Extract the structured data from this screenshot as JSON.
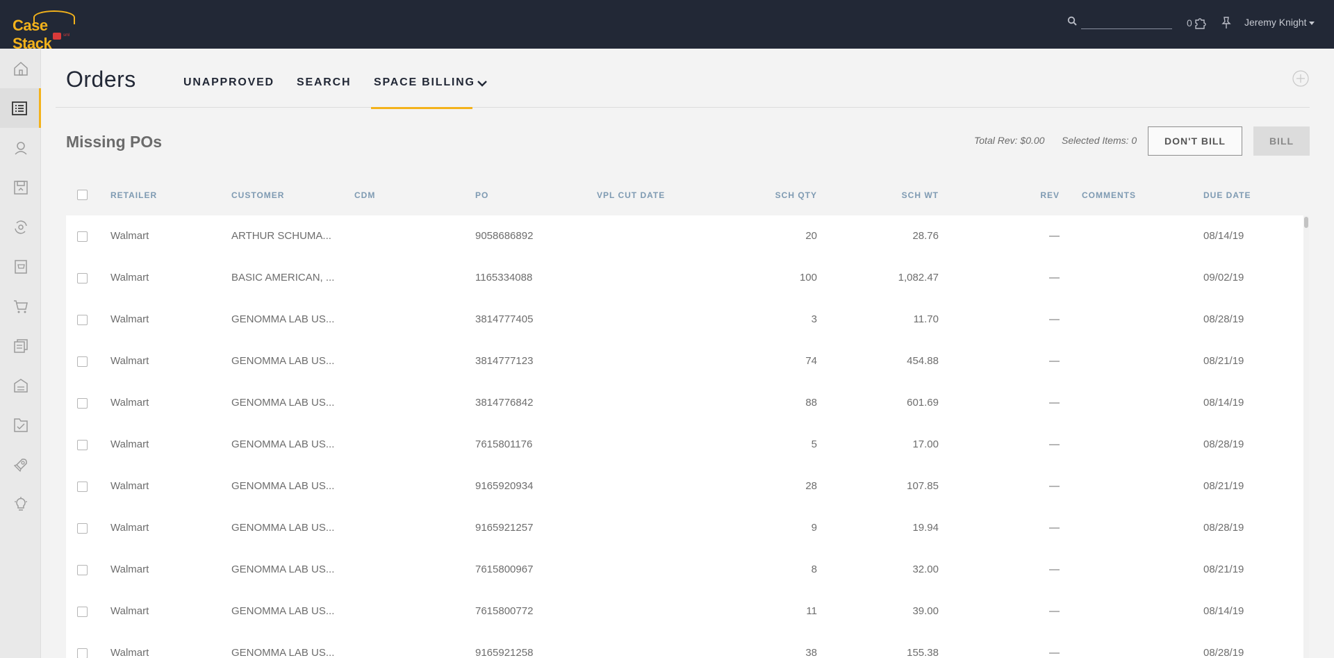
{
  "app": {
    "logo_text": "Case Stack",
    "logo_badge_text": "sml",
    "user_name": "Jeremy Knight",
    "notification_count": "0",
    "search": {
      "placeholder": "",
      "value": ""
    }
  },
  "sidebar": {
    "items": [
      {
        "icon": "home-icon"
      },
      {
        "icon": "orders-list-icon",
        "active": true
      },
      {
        "icon": "contacts-icon"
      },
      {
        "icon": "save-upload-icon"
      },
      {
        "icon": "integrations-icon"
      },
      {
        "icon": "cart-box-icon"
      },
      {
        "icon": "shopping-cart-icon"
      },
      {
        "icon": "documents-icon"
      },
      {
        "icon": "warehouse-icon"
      },
      {
        "icon": "checklist-icon"
      },
      {
        "icon": "rocket-icon"
      },
      {
        "icon": "lightbulb-icon"
      }
    ]
  },
  "header": {
    "title": "Orders",
    "tabs": [
      {
        "label": "UNAPPROVED"
      },
      {
        "label": "SEARCH"
      },
      {
        "label": "SPACE BILLING",
        "active": true
      }
    ]
  },
  "section": {
    "title": "Missing POs",
    "total_rev": "Total Rev: $0.00",
    "selected_items": "Selected Items: 0",
    "dont_bill_label": "DON'T BILL",
    "bill_label": "BILL"
  },
  "table": {
    "columns": [
      "RETAILER",
      "CUSTOMER",
      "CDM",
      "PO",
      "VPL CUT DATE",
      "SCH QTY",
      "SCH WT",
      "REV",
      "COMMENTS",
      "DUE DATE"
    ],
    "rows": [
      {
        "retailer": "Walmart",
        "customer": "ARTHUR SCHUMA...",
        "cdm": "",
        "po": "9058686892",
        "vpl_cut_date": "",
        "sch_qty": "20",
        "sch_wt": "28.76",
        "rev": "—",
        "comments": "",
        "due_date": "08/14/19"
      },
      {
        "retailer": "Walmart",
        "customer": "BASIC AMERICAN, ...",
        "cdm": "",
        "po": "1165334088",
        "vpl_cut_date": "",
        "sch_qty": "100",
        "sch_wt": "1,082.47",
        "rev": "—",
        "comments": "",
        "due_date": "09/02/19"
      },
      {
        "retailer": "Walmart",
        "customer": "GENOMMA LAB US...",
        "cdm": "",
        "po": "3814777405",
        "vpl_cut_date": "",
        "sch_qty": "3",
        "sch_wt": "11.70",
        "rev": "—",
        "comments": "",
        "due_date": "08/28/19"
      },
      {
        "retailer": "Walmart",
        "customer": "GENOMMA LAB US...",
        "cdm": "",
        "po": "3814777123",
        "vpl_cut_date": "",
        "sch_qty": "74",
        "sch_wt": "454.88",
        "rev": "—",
        "comments": "",
        "due_date": "08/21/19"
      },
      {
        "retailer": "Walmart",
        "customer": "GENOMMA LAB US...",
        "cdm": "",
        "po": "3814776842",
        "vpl_cut_date": "",
        "sch_qty": "88",
        "sch_wt": "601.69",
        "rev": "—",
        "comments": "",
        "due_date": "08/14/19"
      },
      {
        "retailer": "Walmart",
        "customer": "GENOMMA LAB US...",
        "cdm": "",
        "po": "7615801176",
        "vpl_cut_date": "",
        "sch_qty": "5",
        "sch_wt": "17.00",
        "rev": "—",
        "comments": "",
        "due_date": "08/28/19"
      },
      {
        "retailer": "Walmart",
        "customer": "GENOMMA LAB US...",
        "cdm": "",
        "po": "9165920934",
        "vpl_cut_date": "",
        "sch_qty": "28",
        "sch_wt": "107.85",
        "rev": "—",
        "comments": "",
        "due_date": "08/21/19"
      },
      {
        "retailer": "Walmart",
        "customer": "GENOMMA LAB US...",
        "cdm": "",
        "po": "9165921257",
        "vpl_cut_date": "",
        "sch_qty": "9",
        "sch_wt": "19.94",
        "rev": "—",
        "comments": "",
        "due_date": "08/28/19"
      },
      {
        "retailer": "Walmart",
        "customer": "GENOMMA LAB US...",
        "cdm": "",
        "po": "7615800967",
        "vpl_cut_date": "",
        "sch_qty": "8",
        "sch_wt": "32.00",
        "rev": "—",
        "comments": "",
        "due_date": "08/21/19"
      },
      {
        "retailer": "Walmart",
        "customer": "GENOMMA LAB US...",
        "cdm": "",
        "po": "7615800772",
        "vpl_cut_date": "",
        "sch_qty": "11",
        "sch_wt": "39.00",
        "rev": "—",
        "comments": "",
        "due_date": "08/14/19"
      },
      {
        "retailer": "Walmart",
        "customer": "GENOMMA LAB US...",
        "cdm": "",
        "po": "9165921258",
        "vpl_cut_date": "",
        "sch_qty": "38",
        "sch_wt": "155.38",
        "rev": "—",
        "comments": "",
        "due_date": "08/28/19"
      }
    ]
  },
  "colors": {
    "topbar": "#222836",
    "accent": "#f3b21b",
    "column_header": "#7e9ab2"
  }
}
